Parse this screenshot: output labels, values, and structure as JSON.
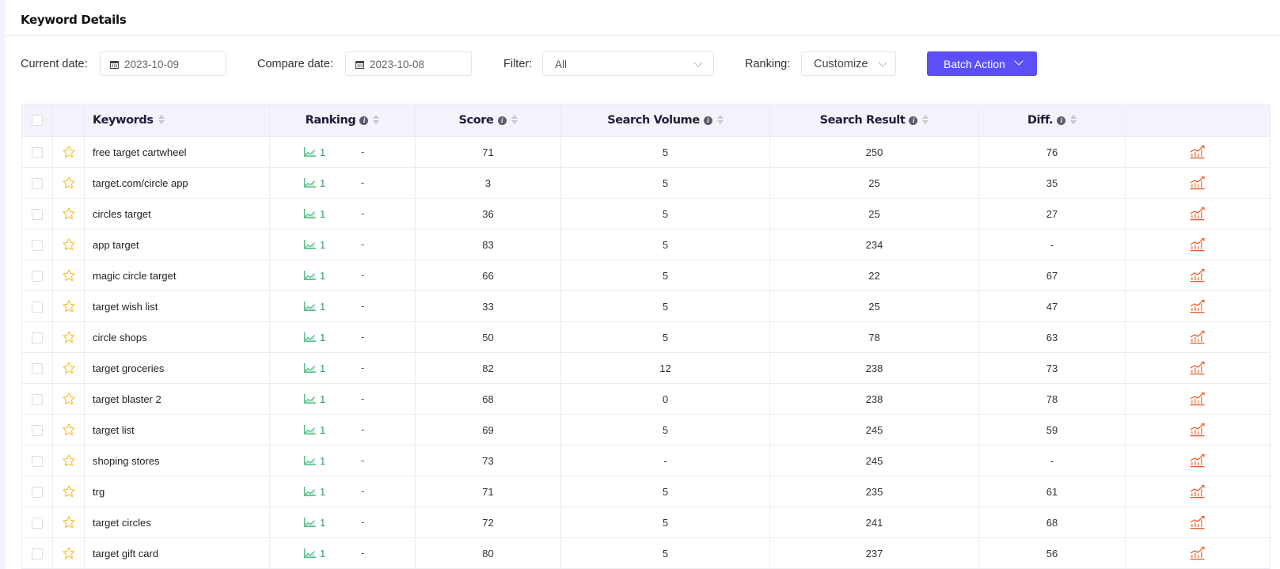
{
  "title": "Keyword Details",
  "toolbar": {
    "current_date_label": "Current date:",
    "current_date_value": "2023-10-09",
    "compare_date_label": "Compare date:",
    "compare_date_value": "2023-10-08",
    "filter_label": "Filter:",
    "filter_value": "All",
    "ranking_label": "Ranking:",
    "ranking_value": "Customize",
    "batch_action_label": "Batch Action"
  },
  "colors": {
    "accent": "#5b4ff5",
    "star": "#f5c02e",
    "rank_up": "#2f9c6b",
    "trend_icon": "#f05a28",
    "header_bg": "#f4f3fc"
  },
  "table": {
    "columns": [
      {
        "key": "keywords",
        "label": "Keywords",
        "info": false
      },
      {
        "key": "ranking",
        "label": "Ranking",
        "info": true
      },
      {
        "key": "score",
        "label": "Score",
        "info": true
      },
      {
        "key": "search_volume",
        "label": "Search Volume",
        "info": true
      },
      {
        "key": "search_result",
        "label": "Search Result",
        "info": true
      },
      {
        "key": "diff",
        "label": "Diff.",
        "info": true
      }
    ],
    "rows": [
      {
        "keyword": "free target cartwheel",
        "ranking": "1",
        "ranking_change": "-",
        "score": "71",
        "search_volume": "5",
        "search_result": "250",
        "diff": "76"
      },
      {
        "keyword": "target.com/circle app",
        "ranking": "1",
        "ranking_change": "-",
        "score": "3",
        "search_volume": "5",
        "search_result": "25",
        "diff": "35"
      },
      {
        "keyword": "circles target",
        "ranking": "1",
        "ranking_change": "-",
        "score": "36",
        "search_volume": "5",
        "search_result": "25",
        "diff": "27"
      },
      {
        "keyword": "app target",
        "ranking": "1",
        "ranking_change": "-",
        "score": "83",
        "search_volume": "5",
        "search_result": "234",
        "diff": "-"
      },
      {
        "keyword": "magic circle target",
        "ranking": "1",
        "ranking_change": "-",
        "score": "66",
        "search_volume": "5",
        "search_result": "22",
        "diff": "67"
      },
      {
        "keyword": "target wish list",
        "ranking": "1",
        "ranking_change": "-",
        "score": "33",
        "search_volume": "5",
        "search_result": "25",
        "diff": "47"
      },
      {
        "keyword": "circle shops",
        "ranking": "1",
        "ranking_change": "-",
        "score": "50",
        "search_volume": "5",
        "search_result": "78",
        "diff": "63"
      },
      {
        "keyword": "target groceries",
        "ranking": "1",
        "ranking_change": "-",
        "score": "82",
        "search_volume": "12",
        "search_result": "238",
        "diff": "73"
      },
      {
        "keyword": "target blaster 2",
        "ranking": "1",
        "ranking_change": "-",
        "score": "68",
        "search_volume": "0",
        "search_result": "238",
        "diff": "78"
      },
      {
        "keyword": "target list",
        "ranking": "1",
        "ranking_change": "-",
        "score": "69",
        "search_volume": "5",
        "search_result": "245",
        "diff": "59"
      },
      {
        "keyword": "shoping stores",
        "ranking": "1",
        "ranking_change": "-",
        "score": "73",
        "search_volume": "-",
        "search_result": "245",
        "diff": "-"
      },
      {
        "keyword": "trg",
        "ranking": "1",
        "ranking_change": "-",
        "score": "71",
        "search_volume": "5",
        "search_result": "235",
        "diff": "61"
      },
      {
        "keyword": "target circles",
        "ranking": "1",
        "ranking_change": "-",
        "score": "72",
        "search_volume": "5",
        "search_result": "241",
        "diff": "68"
      },
      {
        "keyword": "target gift card",
        "ranking": "1",
        "ranking_change": "-",
        "score": "80",
        "search_volume": "5",
        "search_result": "237",
        "diff": "56"
      }
    ]
  },
  "icons": {
    "calendar": "calendar-icon",
    "star": "star-outline-icon",
    "ranking_trend": "line-chart-icon",
    "row_trend": "bar-line-chart-icon",
    "info": "info-icon",
    "sort": "sort-icon",
    "chevron": "chevron-down-icon"
  }
}
